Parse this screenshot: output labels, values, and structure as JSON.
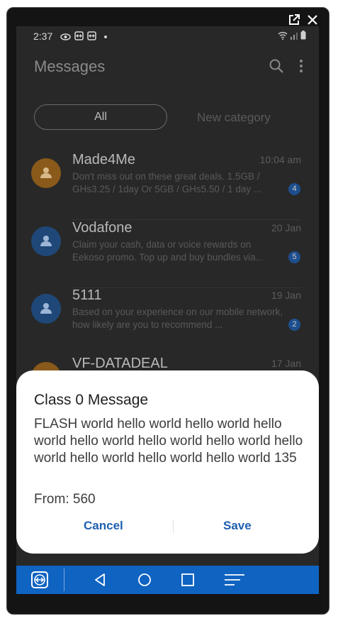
{
  "status_bar": {
    "time": "2:37"
  },
  "app": {
    "title": "Messages"
  },
  "tabs": [
    {
      "label": "All"
    },
    {
      "label": "New category"
    }
  ],
  "conversations": [
    {
      "name": "Made4Me",
      "date": "10:04 am",
      "snippet": "Don't miss out on these great deals. 1.5GB / GHs3.25 / 1day Or 5GB / GHs5.50 / 1 day ...",
      "unread": "4",
      "avatar_color": "#8a5a1a"
    },
    {
      "name": "Vodafone",
      "date": "20 Jan",
      "snippet": "Claim your cash, data or voice rewards on Eekoso promo. Top up and buy bundles via...",
      "unread": "5",
      "avatar_color": "#1f4878"
    },
    {
      "name": "5111",
      "date": "19 Jan",
      "snippet": "Based on your experience on our mobile network, how likely are you to recommend ...",
      "unread": "2",
      "avatar_color": "#1f4878"
    },
    {
      "name": "VF-DATADEAL",
      "date": "17 Jan",
      "snippet": "",
      "unread": "",
      "avatar_color": "#8a5a1a"
    }
  ],
  "dialog": {
    "title": "Class 0 Message",
    "body": "FLASH world hello world hello world hello world hello world hello world hello world hello world hello world hello world hello world 135",
    "from": "From: 560",
    "cancel_label": "Cancel",
    "save_label": "Save"
  },
  "colors": {
    "accent": "#1d5fb0",
    "navbar": "#0f63c1"
  }
}
